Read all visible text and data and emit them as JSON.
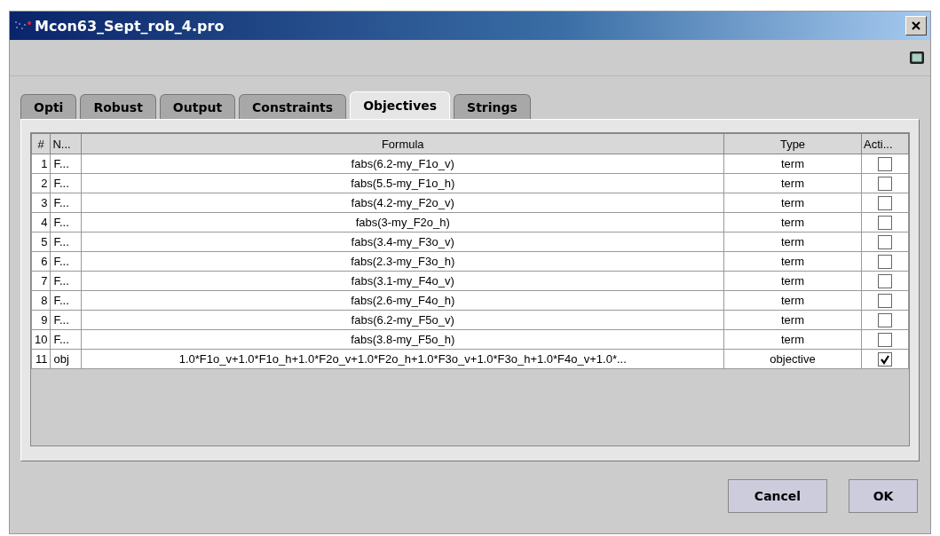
{
  "window": {
    "title": "Mcon63_Sept_rob_4.pro"
  },
  "tabs": [
    {
      "label": "Opti",
      "selected": false
    },
    {
      "label": "Robust",
      "selected": false
    },
    {
      "label": "Output",
      "selected": false
    },
    {
      "label": "Constraints",
      "selected": false
    },
    {
      "label": "Objectives",
      "selected": true
    },
    {
      "label": "Strings",
      "selected": false
    }
  ],
  "table": {
    "columns": [
      "#",
      "N...",
      "Formula",
      "Type",
      "Acti..."
    ],
    "rows": [
      {
        "number": "1",
        "name": "F...",
        "formula": "fabs(6.2-my_F1o_v)",
        "type": "term",
        "checked": false
      },
      {
        "number": "2",
        "name": "F...",
        "formula": "fabs(5.5-my_F1o_h)",
        "type": "term",
        "checked": false
      },
      {
        "number": "3",
        "name": "F...",
        "formula": "fabs(4.2-my_F2o_v)",
        "type": "term",
        "checked": false
      },
      {
        "number": "4",
        "name": "F...",
        "formula": "fabs(3-my_F2o_h)",
        "type": "term",
        "checked": false
      },
      {
        "number": "5",
        "name": "F...",
        "formula": "fabs(3.4-my_F3o_v)",
        "type": "term",
        "checked": false
      },
      {
        "number": "6",
        "name": "F...",
        "formula": "fabs(2.3-my_F3o_h)",
        "type": "term",
        "checked": false
      },
      {
        "number": "7",
        "name": "F...",
        "formula": "fabs(3.1-my_F4o_v)",
        "type": "term",
        "checked": false
      },
      {
        "number": "8",
        "name": "F...",
        "formula": "fabs(2.6-my_F4o_h)",
        "type": "term",
        "checked": false
      },
      {
        "number": "9",
        "name": "F...",
        "formula": "fabs(6.2-my_F5o_v)",
        "type": "term",
        "checked": false
      },
      {
        "number": "10",
        "name": "F...",
        "formula": "fabs(3.8-my_F5o_h)",
        "type": "term",
        "checked": false
      },
      {
        "number": "11",
        "name": "obj",
        "formula": "1.0*F1o_v+1.0*F1o_h+1.0*F2o_v+1.0*F2o_h+1.0*F3o_v+1.0*F3o_h+1.0*F4o_v+1.0*...",
        "type": "objective",
        "checked": true
      }
    ]
  },
  "buttons": [
    "Cancel",
    "OK"
  ]
}
